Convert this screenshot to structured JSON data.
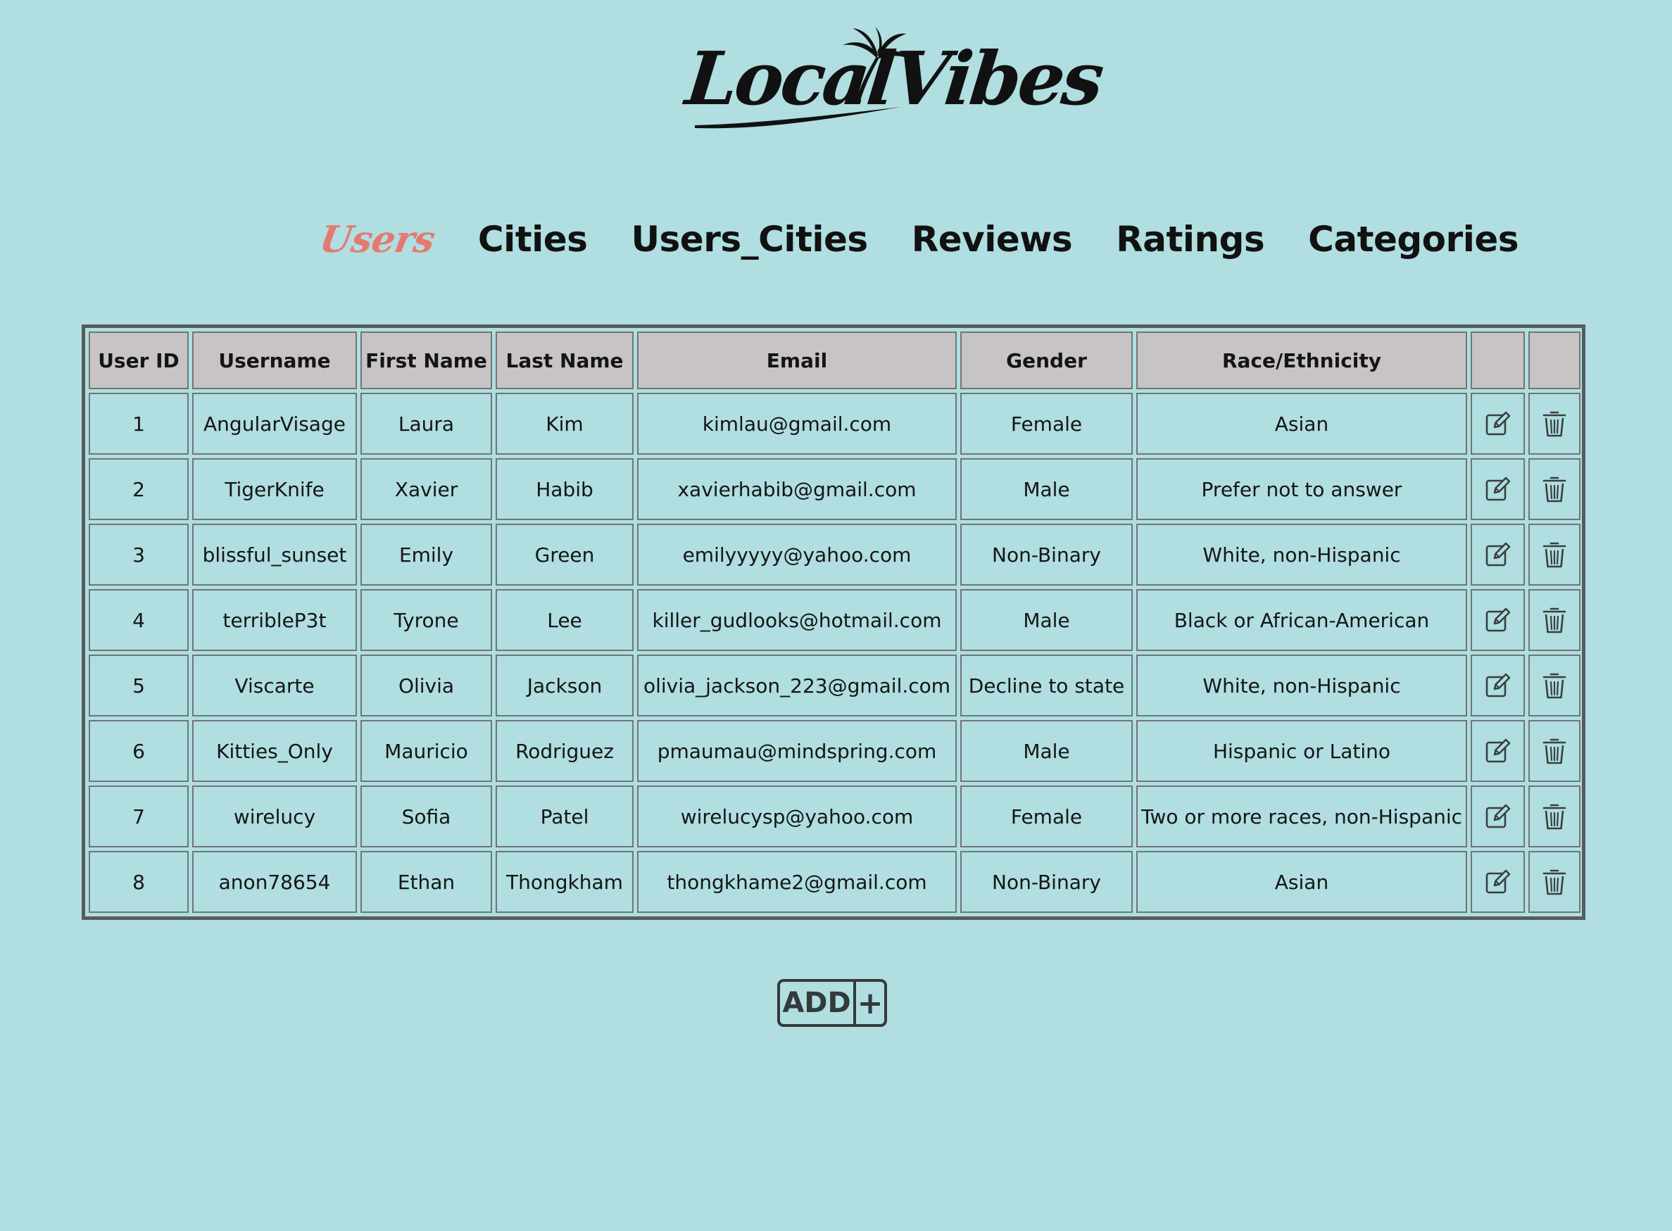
{
  "app": {
    "logo_text": "LocalVibes"
  },
  "nav": {
    "items": [
      {
        "label": "Users",
        "active": true
      },
      {
        "label": "Cities",
        "active": false
      },
      {
        "label": "Users_Cities",
        "active": false
      },
      {
        "label": "Reviews",
        "active": false
      },
      {
        "label": "Ratings",
        "active": false
      },
      {
        "label": "Categories",
        "active": false
      }
    ]
  },
  "table": {
    "headers": [
      "User ID",
      "Username",
      "First Name",
      "Last Name",
      "Email",
      "Gender",
      "Race/Ethnicity",
      "",
      ""
    ],
    "rows": [
      [
        "1",
        "AngularVisage",
        "Laura",
        "Kim",
        "kimlau@gmail.com",
        "Female",
        "Asian"
      ],
      [
        "2",
        "TigerKnife",
        "Xavier",
        "Habib",
        "xavierhabib@gmail.com",
        "Male",
        "Prefer not to answer"
      ],
      [
        "3",
        "blissful_sunset",
        "Emily",
        "Green",
        "emilyyyyy@yahoo.com",
        "Non-Binary",
        "White, non-Hispanic"
      ],
      [
        "4",
        "terribleP3t",
        "Tyrone",
        "Lee",
        "killer_gudlooks@hotmail.com",
        "Male",
        "Black or African-American"
      ],
      [
        "5",
        "Viscarte",
        "Olivia",
        "Jackson",
        "olivia_jackson_223@gmail.com",
        "Decline to state",
        "White, non-Hispanic"
      ],
      [
        "6",
        "Kitties_Only",
        "Mauricio",
        "Rodriguez",
        "pmaumau@mindspring.com",
        "Male",
        "Hispanic or Latino"
      ],
      [
        "7",
        "wirelucy",
        "Sofia",
        "Patel",
        "wirelucysp@yahoo.com",
        "Female",
        "Two or more races, non-Hispanic"
      ],
      [
        "8",
        "anon78654",
        "Ethan",
        "Thongkham",
        "thongkhame2@gmail.com",
        "Non-Binary",
        "Asian"
      ]
    ],
    "row_actions": [
      "edit-icon",
      "trash-icon"
    ]
  },
  "add_button": {
    "label": "ADD",
    "plus": "+"
  },
  "colors": {
    "background": "#b0dee1",
    "header_bg": "#c9c4c4",
    "active_nav": "#e47a6f",
    "border": "#565c5c"
  }
}
